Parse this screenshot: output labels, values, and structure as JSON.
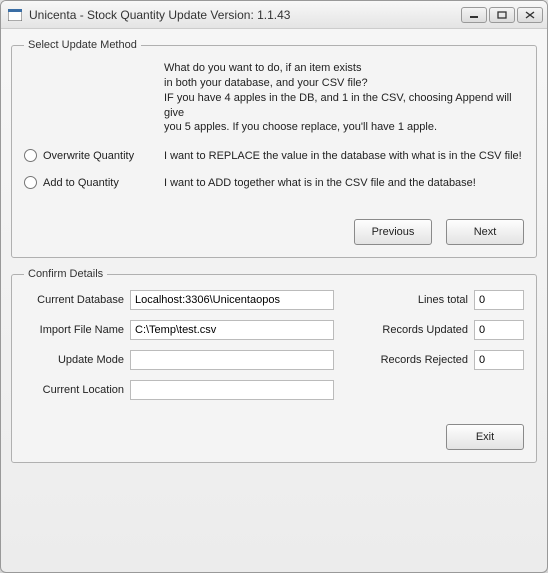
{
  "window": {
    "title": "Unicenta - Stock Quantity Update Version: 1.1.43"
  },
  "update_method": {
    "legend": "Select Update Method",
    "intro_l1": "What do you want to do, if an item exists",
    "intro_l2": "in both your database, and your CSV file?",
    "intro_l3": "IF you have 4 apples in the DB, and 1 in the CSV, choosing Append will give",
    "intro_l4": "you 5 apples. If you choose replace, you'll have 1 apple.",
    "overwrite_label": "Overwrite Quantity",
    "overwrite_desc": "I want to REPLACE the value in the database with what is in the CSV file!",
    "add_label": "Add to Quantity",
    "add_desc": "I want to ADD together what is in the CSV file and the database!",
    "previous_label": "Previous",
    "next_label": "Next"
  },
  "confirm": {
    "legend": "Confirm Details",
    "current_database_label": "Current Database",
    "current_database_value": "Localhost:3306\\Unicentaopos",
    "import_file_label": "Import File Name",
    "import_file_value": "C:\\Temp\\test.csv",
    "update_mode_label": "Update Mode",
    "update_mode_value": "",
    "current_location_label": "Current Location",
    "current_location_value": "",
    "lines_total_label": "Lines total",
    "lines_total_value": "0",
    "records_updated_label": "Records Updated",
    "records_updated_value": "0",
    "records_rejected_label": "Records Rejected",
    "records_rejected_value": "0",
    "exit_label": "Exit"
  }
}
